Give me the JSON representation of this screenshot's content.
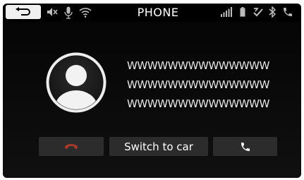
{
  "header": {
    "title": "PHONE"
  },
  "status_icons": [
    "back-arrow-icon",
    "mute-icon",
    "microphone-icon",
    "wifi-icon",
    "signal-bars-icon",
    "battery-icon",
    "connection-icon",
    "bluetooth-icon",
    "phone-icon"
  ],
  "caller": {
    "lines": [
      "WWWWWWWWWWWWWW",
      "WWWWWWWWWWWWWW",
      "WWWWWWWWWWWWWW"
    ]
  },
  "actions": {
    "switch_label": "Switch to car"
  },
  "colors": {
    "background": "#000000",
    "button_bg": "#2c2c2c",
    "end_call": "#a83a2c",
    "accept_call": "#ffffff"
  }
}
